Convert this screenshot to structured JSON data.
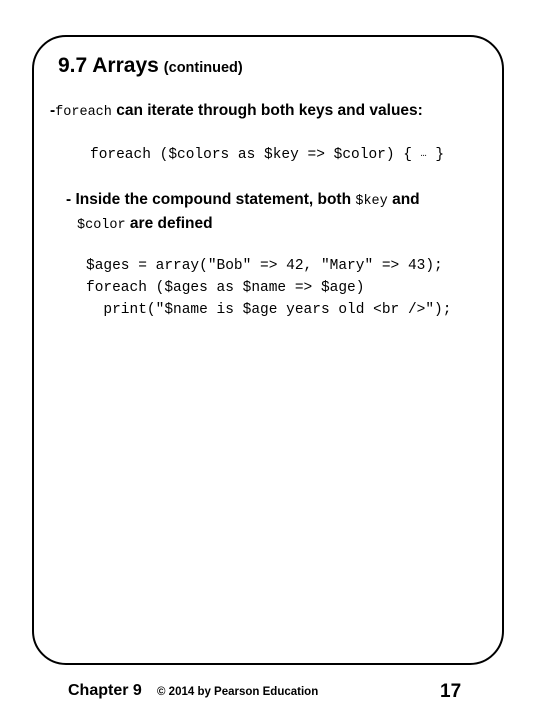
{
  "slide": {
    "title": {
      "main": "9.7 Arrays",
      "sub": "(continued)"
    },
    "bullet_1": {
      "dash": "-",
      "code_term": "foreach",
      "text": " can iterate through both keys and values:"
    },
    "inline_code": {
      "before": "foreach ($colors as $key => $color) { ",
      "ellipsis": "…",
      "after": " }"
    },
    "bullet_2": {
      "dash": "-",
      "text_before": " Inside the compound statement, both ",
      "code_1": "$key",
      "text_middle": " and",
      "code_2": "$color",
      "text_after": " are defined"
    },
    "code_block": {
      "line_1": "$ages = array(\"Bob\" => 42, \"Mary\" => 43);",
      "line_2": "foreach ($ages as $name => $age)",
      "line_3": "  print(\"$name is $age years old <br />\");"
    }
  },
  "footer": {
    "chapter": "Chapter 9",
    "copyright": "© 2014 by Pearson Education",
    "page_number": "17"
  }
}
